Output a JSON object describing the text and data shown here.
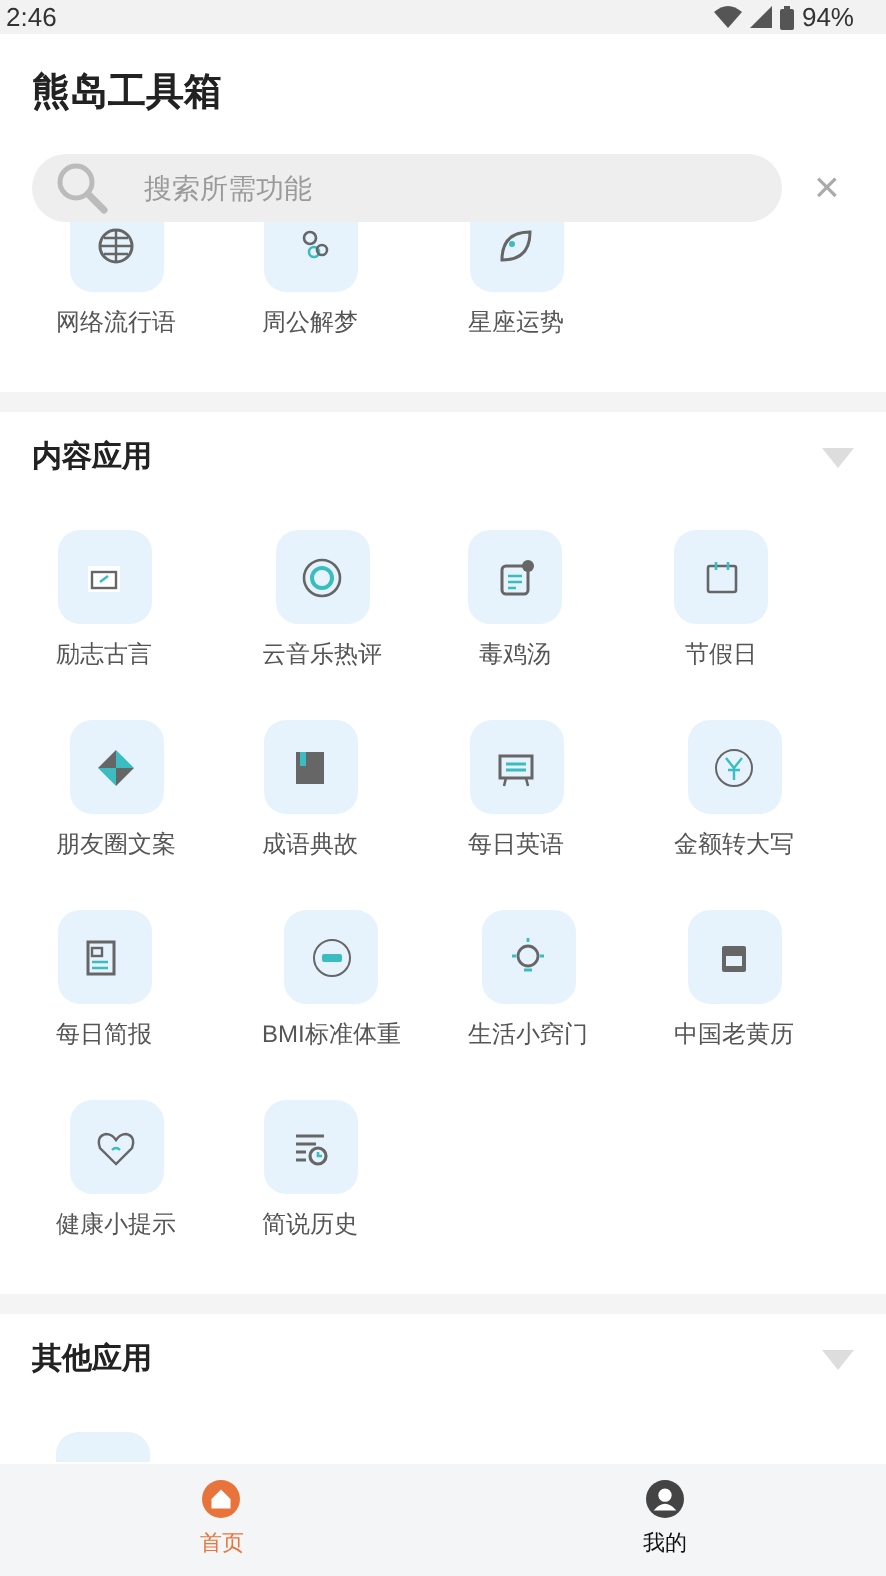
{
  "status_bar": {
    "time": "2:46",
    "battery": "94%"
  },
  "app_title": "熊岛工具箱",
  "search": {
    "placeholder": "搜索所需功能",
    "clear": "×"
  },
  "sections": [
    {
      "tools": [
        {
          "kind": "app",
          "label": "网络流行语"
        },
        {
          "kind": "app",
          "label": "周公解梦"
        },
        {
          "kind": "app",
          "label": "星座运势"
        }
      ]
    },
    {
      "title": "内容应用",
      "tools": [
        {
          "kind": "app",
          "label": "励志古言"
        },
        {
          "kind": "app",
          "label": "云音乐热评"
        },
        {
          "kind": "app",
          "label": "毒鸡汤"
        },
        {
          "kind": "app",
          "label": "节假日"
        },
        {
          "kind": "app",
          "label": "朋友圈文案"
        },
        {
          "kind": "app",
          "label": "成语典故"
        },
        {
          "kind": "app",
          "label": "每日英语"
        },
        {
          "kind": "app",
          "label": "金额转大写"
        },
        {
          "kind": "app",
          "label": "每日简报"
        },
        {
          "kind": "app",
          "label": "BMI标准体重"
        },
        {
          "kind": "app",
          "label": "生活小窍门"
        },
        {
          "kind": "app",
          "label": "中国老黄历"
        },
        {
          "kind": "app",
          "label": "健康小提示"
        },
        {
          "kind": "app",
          "label": "简说历史"
        }
      ]
    },
    {
      "title": "其他应用",
      "tools": [
        {
          "kind": "icon_only"
        }
      ]
    }
  ],
  "bottom_nav": [
    {
      "label": "首页",
      "selected": true
    },
    {
      "label": "我的",
      "selected": false
    }
  ]
}
